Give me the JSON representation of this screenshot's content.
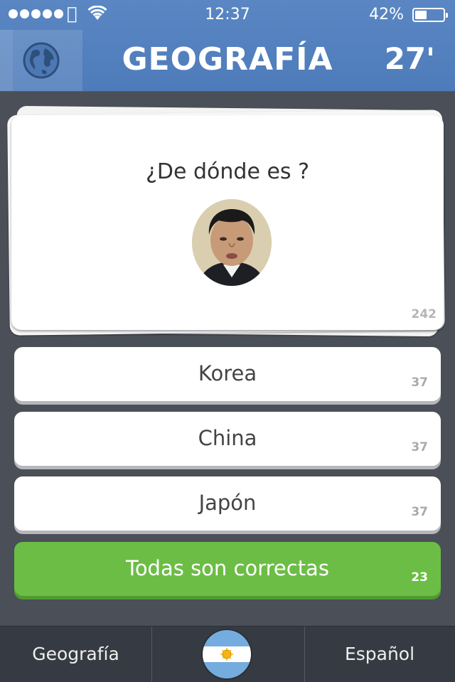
{
  "status_bar": {
    "time": "12:37",
    "battery_percent": "42%",
    "battery_level": 0.42
  },
  "header": {
    "title": "GEOGRAFÍA",
    "timer": "27'",
    "category_icon": "globe-icon",
    "color": "#5a87c4"
  },
  "question": {
    "text": "¿De dónde es ?",
    "image": "portrait-photo",
    "count": "242"
  },
  "answers": [
    {
      "label": "Korea",
      "count": "37",
      "correct": false
    },
    {
      "label": "China",
      "count": "37",
      "correct": false
    },
    {
      "label": "Japón",
      "count": "37",
      "correct": false
    },
    {
      "label": "Todas son correctas",
      "count": "23",
      "correct": true
    }
  ],
  "colors": {
    "correct": "#6cbd45",
    "background": "#4a4f58"
  },
  "bottom_bar": {
    "category": "Geografía",
    "flag": "argentina-flag-icon",
    "language": "Español"
  }
}
